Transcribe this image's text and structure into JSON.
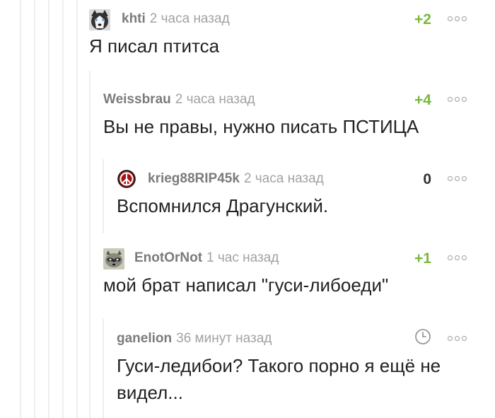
{
  "comments": [
    {
      "author": "khti",
      "time": "2 часа назад",
      "rating": "+2",
      "text": "Я писал птитса",
      "avatar": "husky-avatar"
    },
    {
      "author": "Weissbrau",
      "time": "2 часа назад",
      "rating": "+4",
      "text": "Вы не правы, нужно писать ПСТИЦА"
    },
    {
      "author": "krieg88RIP45k",
      "time": "2 часа назад",
      "rating": "0",
      "text": "Вспомнился Драгунский.",
      "avatar": "peace-sign-avatar"
    },
    {
      "author": "EnotOrNot",
      "time": "1 час назад",
      "rating": "+1",
      "text": "мой брат написал \"гуси-либоеди\"",
      "avatar": "raccoon-avatar"
    },
    {
      "author": "ganelion",
      "time": "36 минут назад",
      "rating_icon": "clock-icon",
      "text": "Гуси-ледибои? Такого порно я ещё не видел..."
    }
  ],
  "colors": {
    "positive_rating": "#7ab83e",
    "zero_rating": "#333333",
    "author": "#7b7b7b",
    "time": "#a2a2a2",
    "thread_line": "#eeeeee"
  }
}
